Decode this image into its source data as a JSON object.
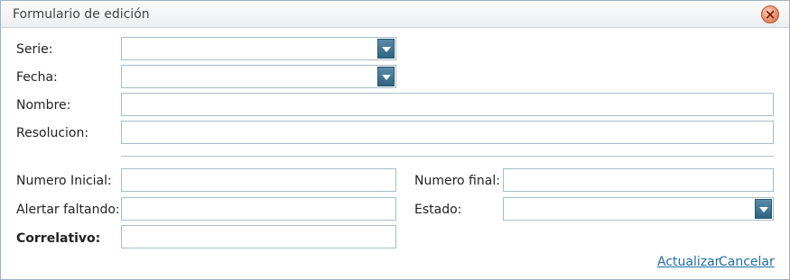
{
  "window": {
    "title": "Formulario de edición",
    "close_glyph": "×"
  },
  "form": {
    "serie": {
      "label": "Serie:",
      "value": ""
    },
    "fecha": {
      "label": "Fecha:",
      "value": ""
    },
    "nombre": {
      "label": "Nombre:",
      "value": ""
    },
    "resolucion": {
      "label": "Resolucion:",
      "value": ""
    },
    "numero_inicial": {
      "label": "Numero Inicial:",
      "value": ""
    },
    "numero_final": {
      "label": "Numero final:",
      "value": ""
    },
    "alertar_faltando": {
      "label": "Alertar faltando:",
      "value": ""
    },
    "estado": {
      "label": "Estado:",
      "value": ""
    },
    "correlativo": {
      "label": "Correlativo:",
      "value": ""
    }
  },
  "actions": {
    "update_label": "Actualizar",
    "cancel_label": "Cancelar"
  },
  "icons": {
    "close": "close-icon",
    "dropdown": "chevron-down-icon"
  },
  "colors": {
    "border": "#a8bcc6",
    "dropdown_button": "#2f6482",
    "link": "#1f6fa3",
    "close_button": "#e78c6a"
  }
}
